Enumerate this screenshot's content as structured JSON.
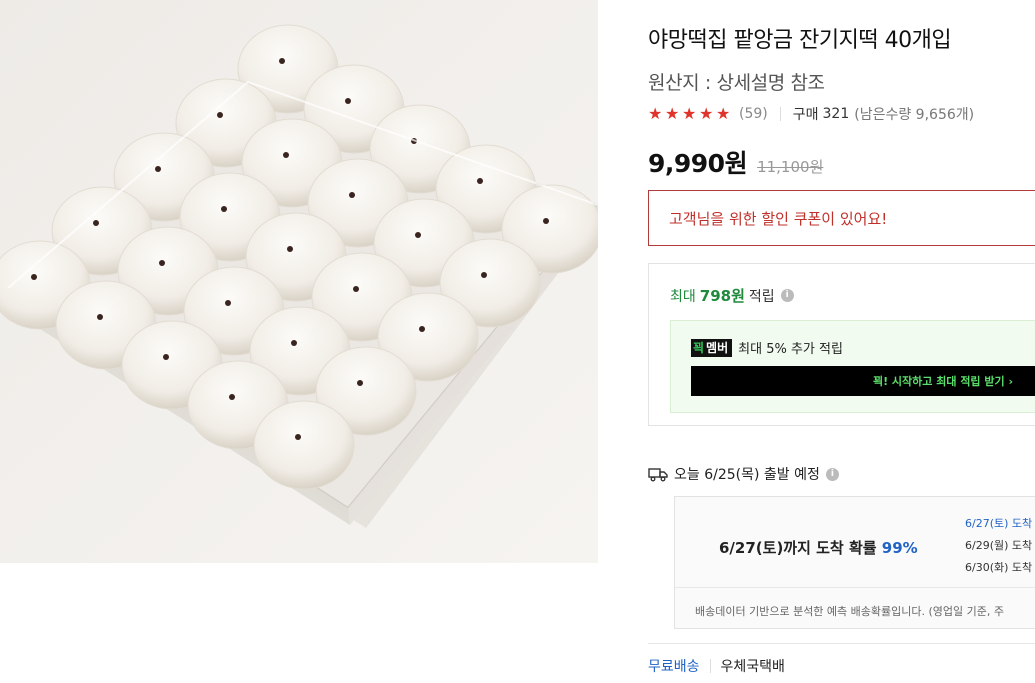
{
  "product": {
    "title": "야망떡집 팥앙금 잔기지떡 40개입",
    "origin": "원산지 : 상세설명 참조",
    "rating_stars": 5,
    "review_count": "(59)",
    "purchase_label": "구매",
    "purchase_count": "321",
    "stock_text": "(남은수량 9,656개)",
    "price": "9,990원",
    "original_price": "11,100원"
  },
  "coupon": {
    "text": "고객님을 위한 할인 쿠폰이 있어요!"
  },
  "points": {
    "prefix": "최대",
    "amount": "798원",
    "suffix": "적립",
    "info_icon": "i"
  },
  "membership": {
    "badge_g": "꾁",
    "badge_w": "멤버",
    "text": "최대 5% 추가 적립",
    "cta": "꾁! 시작하고 최대 적립 받기 ›"
  },
  "delivery": {
    "departure": "오늘 6/25(목) 출발 예정",
    "arrival_main": "6/27(토)까지 도착 확률",
    "arrival_pct": "99%",
    "dates": [
      "6/27(토) 도착",
      "6/29(월) 도착",
      "6/30(화) 도착"
    ],
    "note": "배송데이터 기반으로 분석한 예측 배송확률입니다. (영업일 기준, 주"
  },
  "shipping": {
    "free": "무료배송",
    "carrier": "우체국택배"
  },
  "colors": {
    "star": "#e0332b",
    "coupon_border": "#b43a3a",
    "points_green": "#1f8a3c",
    "link_blue": "#2163c5"
  }
}
